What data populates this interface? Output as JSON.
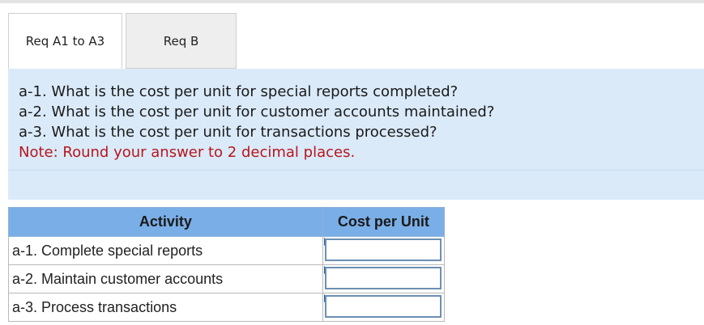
{
  "tabs": [
    {
      "label": "Req A1 to A3"
    },
    {
      "label": "Req B"
    }
  ],
  "question": {
    "lines": [
      "a-1. What is the cost per unit for special reports completed?",
      "a-2. What is the cost per unit for customer accounts maintained?",
      "a-3. What is the cost per unit for transactions processed?"
    ],
    "note": "Note: Round your answer to 2 decimal places."
  },
  "table": {
    "headers": {
      "activity": "Activity",
      "cost": "Cost per Unit"
    },
    "rows": [
      {
        "activity": "a-1. Complete special reports",
        "value": ""
      },
      {
        "activity": "a-2. Maintain customer accounts",
        "value": ""
      },
      {
        "activity": "a-3. Process transactions",
        "value": ""
      }
    ]
  },
  "colors": {
    "panel_background": "#daeaf9",
    "header_background": "#7aaee6",
    "note_text": "#b8161c",
    "input_border": "#6d8fb3"
  }
}
